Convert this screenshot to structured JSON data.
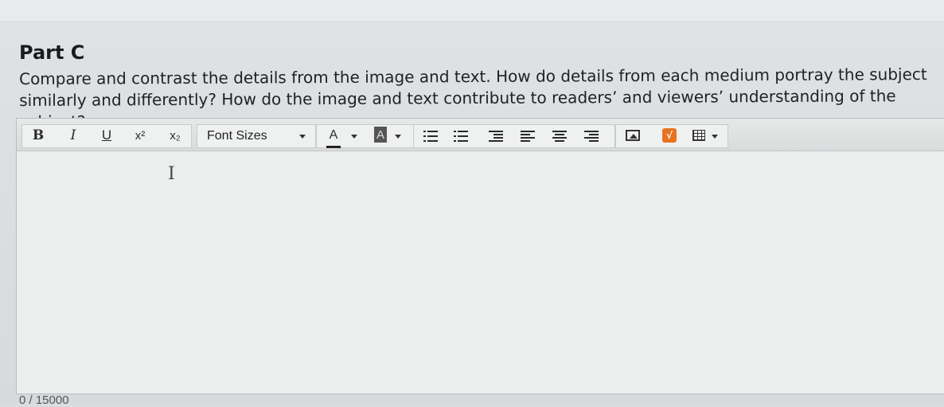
{
  "part": {
    "title": "Part C"
  },
  "question": {
    "line1": "Compare and contrast the details from the image and text. How do details from each medium portray the subject",
    "line2": "similarly and differently? How do the image and text contribute to readers’ and viewers’ understanding of the subject?"
  },
  "toolbar": {
    "bold": "B",
    "italic": "I",
    "underline": "U",
    "superscript": "x²",
    "subscript": "x₂",
    "font_sizes": "Font Sizes",
    "font_color": "A",
    "highlight": "A",
    "icons": [
      "bullet-list-icon",
      "numbered-list-icon",
      "indent-icon",
      "align-left-icon",
      "align-center-icon",
      "align-right-icon",
      "insert-image-icon",
      "math-equation-icon",
      "table-icon"
    ]
  },
  "editor": {
    "cursor": "I"
  },
  "footer": {
    "word_count": "0 / 15000"
  },
  "colors": {
    "accent_orange": "#e8731f",
    "background": "#d9dde0"
  }
}
